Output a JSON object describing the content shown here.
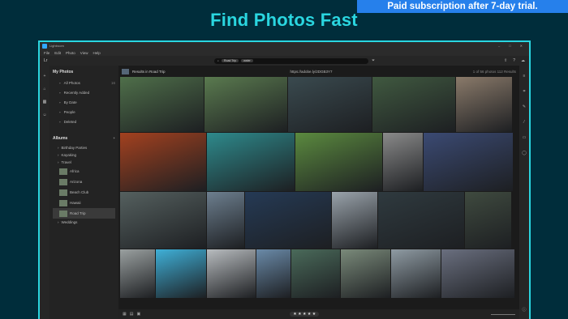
{
  "headline": "Find Photos Fast",
  "banner": "Paid subscription after 7-day trial.",
  "window": {
    "title": "Lightroom"
  },
  "menu": [
    "File",
    "Edit",
    "Photo",
    "View",
    "Help"
  ],
  "toolbar": {
    "lr_label": "Lr",
    "chips": [
      "Road Trip",
      "water"
    ]
  },
  "panel": {
    "my_photos": "My Photos",
    "items": [
      {
        "label": "All Photos",
        "count": "16"
      },
      {
        "label": "Recently Added",
        "count": ""
      },
      {
        "label": "By Date",
        "count": ""
      },
      {
        "label": "People",
        "count": ""
      },
      {
        "label": "Deleted",
        "count": ""
      }
    ],
    "albums_title": "Albums",
    "albums": [
      {
        "label": "Birthday Parties",
        "sub": false
      },
      {
        "label": "Kayaking",
        "sub": false
      },
      {
        "label": "Travel",
        "sub": false
      },
      {
        "label": "Africa",
        "sub": true
      },
      {
        "label": "Arizona",
        "sub": true
      },
      {
        "label": "Beach Club",
        "sub": true
      },
      {
        "label": "Hawaii",
        "sub": true
      },
      {
        "label": "Road Trip",
        "sub": true,
        "selected": true
      },
      {
        "label": "Weddings",
        "sub": false
      }
    ]
  },
  "main": {
    "title": "Results in Road Trip",
    "url": "https://adobe.ly/2DGB3Y7",
    "stats": "1 of 56 photos  112 Results"
  },
  "rating": "★ ★ ★ ★ ★",
  "photo_rows": [
    [
      {
        "label": "forest-lake",
        "w": 103,
        "color": "#4f6f4a"
      },
      {
        "label": "stone-wall-forest",
        "w": 102,
        "color": "#5a7a4f"
      },
      {
        "label": "tree-roots-river",
        "w": 103,
        "color": "#3a4a4f"
      },
      {
        "label": "waterfall-cave",
        "w": 102,
        "color": "#405940"
      },
      {
        "label": "pier-pilings",
        "w": 69,
        "color": "#8a7a6a"
      }
    ],
    [
      {
        "label": "sunset-lake",
        "w": 106,
        "color": "#a3411f"
      },
      {
        "label": "turquoise-lake-woman",
        "w": 108,
        "color": "#2e8a8c"
      },
      {
        "label": "willow-trees",
        "w": 107,
        "color": "#5b8a3f"
      },
      {
        "label": "woman-portrait",
        "w": 49,
        "color": "#8a8a8a"
      },
      {
        "label": "coastal-town-night",
        "w": 110,
        "color": "#3b4a73"
      }
    ],
    [
      {
        "label": "mountain-hills",
        "w": 106,
        "color": "#55605f"
      },
      {
        "label": "river-boulders",
        "w": 46,
        "color": "#6d7f8f"
      },
      {
        "label": "moonlit-sea",
        "w": 106,
        "color": "#253a55"
      },
      {
        "label": "woman-sea",
        "w": 56,
        "color": "#9aa3ab"
      },
      {
        "label": "kayak-river",
        "w": 106,
        "color": "#2f3a3f"
      },
      {
        "label": "feet-dock",
        "w": 57,
        "color": "#3f4a3f"
      }
    ],
    [
      {
        "label": "beach-pier",
        "w": 49,
        "color": "#9aa0a0"
      },
      {
        "label": "pool-floats",
        "w": 69,
        "color": "#3fb0d8"
      },
      {
        "label": "bird-beach",
        "w": 68,
        "color": "#b8bcbf"
      },
      {
        "label": "person-hat",
        "w": 47,
        "color": "#6a8aa8"
      },
      {
        "label": "waterfall",
        "w": 68,
        "color": "#4a6a5a"
      },
      {
        "label": "hand-rock",
        "w": 69,
        "color": "#7a8a7a"
      },
      {
        "label": "woman-lake",
        "w": 69,
        "color": "#8f9ba3"
      },
      {
        "label": "mountain-valley",
        "w": 101,
        "color": "#6a6f7f"
      }
    ]
  ]
}
